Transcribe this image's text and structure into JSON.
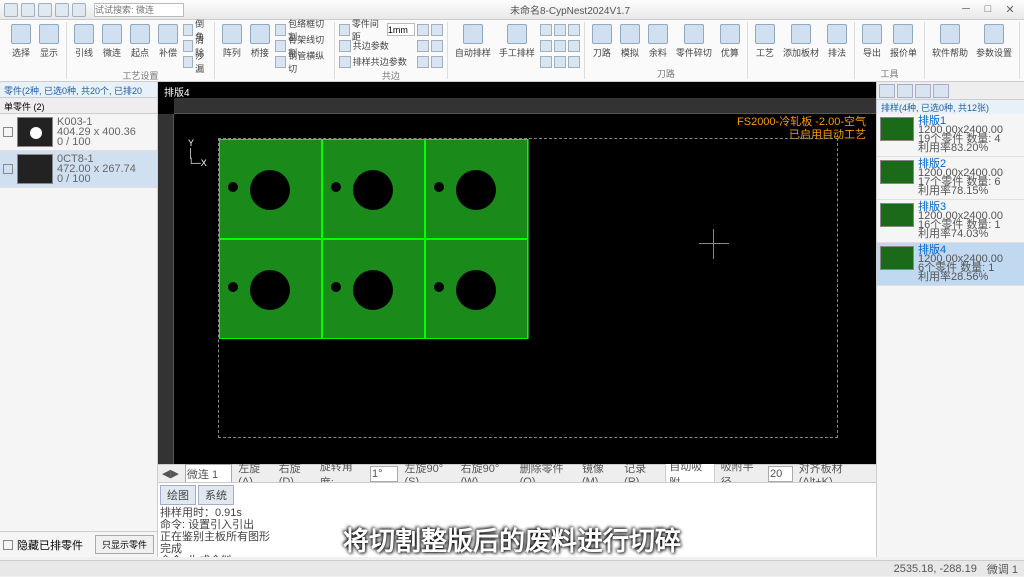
{
  "titlebar": {
    "title": "未命名8-CypNest2024V1.7",
    "search_placeholder": "试试搜索: 微连"
  },
  "ribbon": {
    "groups": [
      {
        "label": "",
        "buttons": [
          {
            "t": "选择"
          },
          {
            "t": "显示"
          }
        ]
      },
      {
        "label": "工艺设置",
        "buttons": [
          {
            "t": "引线"
          },
          {
            "t": "微连"
          },
          {
            "t": "起点"
          },
          {
            "t": "补偿"
          }
        ],
        "rows": [
          {
            "t": "倒角"
          },
          {
            "t": "清除"
          },
          {
            "t": "沙漏"
          }
        ]
      },
      {
        "label": "",
        "buttons": [
          {
            "t": "阵列"
          },
          {
            "t": "桥接"
          }
        ],
        "rows": [
          {
            "t": "包络框切割"
          },
          {
            "t": "骨架线切割"
          },
          {
            "t": "钢管横纵切"
          }
        ]
      },
      {
        "label": "共边",
        "rows": [
          {
            "t": "零件间距",
            "v": "1mm"
          },
          {
            "t": "共边参数"
          },
          {
            "t": "排样共边参数"
          }
        ],
        "icons": 6
      },
      {
        "label": "",
        "buttons": [
          {
            "t": "自动排样"
          },
          {
            "t": "手工排样"
          }
        ],
        "rows": 3
      },
      {
        "label": "刀路",
        "buttons": [
          {
            "t": "刀路"
          },
          {
            "t": "模拟"
          },
          {
            "t": "余料"
          },
          {
            "t": "零件碎切"
          },
          {
            "t": "优算"
          }
        ]
      },
      {
        "label": "",
        "buttons": [
          {
            "t": "工艺"
          },
          {
            "t": "添加板材"
          },
          {
            "t": "排法"
          }
        ]
      },
      {
        "label": "工具",
        "buttons": [
          {
            "t": "导出"
          },
          {
            "t": "报价单"
          }
        ]
      },
      {
        "label": "",
        "buttons": [
          {
            "t": "软件帮助"
          },
          {
            "t": "参数设置"
          }
        ]
      }
    ]
  },
  "leftpanel": {
    "header": "零件(2种, 已选0种, 共20个, 已排20个)",
    "tab": "单零件  (2)",
    "parts": [
      {
        "name": "K003-1",
        "dim": "404.29 x 400.36",
        "count": "0 / 100"
      },
      {
        "name": "0CT8-1",
        "dim": "472.00 x 267.74",
        "count": "0 / 100"
      }
    ],
    "footer": {
      "cb": "隐藏已排零件",
      "btn": "只显示零件"
    }
  },
  "canvas": {
    "tab": "排版4",
    "material": "FS2000-冷轧板 -2.00-空气",
    "auto": "已启用自动工艺"
  },
  "bottombar": {
    "items": [
      "微连 1",
      "左旋(A)",
      "右旋(D)",
      "旋转角度:",
      "1°",
      "左旋90°(S)",
      "右旋90°(W)",
      "删除零件(Q)",
      "镜像(M)",
      "记录(R)",
      "自动吸附",
      "吸附半径",
      "20",
      "对齐板材(Alt+K)"
    ]
  },
  "log": {
    "tabs": [
      "绘图",
      "系统"
    ],
    "lines": [
      "排样用时：0.91s",
      "命令: 设置引入引出",
      "正在鉴别主板所有图形",
      "完成",
      "命令: 生成余料"
    ]
  },
  "rightpanel": {
    "header": "排样(4种, 已选0种, 共12张)",
    "sheets": [
      {
        "name": "排版1",
        "dim": "1200.00x2400.00",
        "parts": "19个零件",
        "qty": "数量: 4",
        "util": "利用率83.20%"
      },
      {
        "name": "排版2",
        "dim": "1200.00x2400.00",
        "parts": "17个零件",
        "qty": "数量: 6",
        "util": "利用率78.15%"
      },
      {
        "name": "排版3",
        "dim": "1200.00x2400.00",
        "parts": "16个零件",
        "qty": "数量: 1",
        "util": "利用率74.03%"
      },
      {
        "name": "排版4",
        "dim": "1200.00x2400.00",
        "parts": "6个零件",
        "qty": "数量: 1",
        "util": "利用率28.56%"
      }
    ]
  },
  "statusbar": {
    "coords": "2535.18, -288.19",
    "zoom": "微调 1"
  },
  "subtitle": "将切割整版后的废料进行切碎"
}
